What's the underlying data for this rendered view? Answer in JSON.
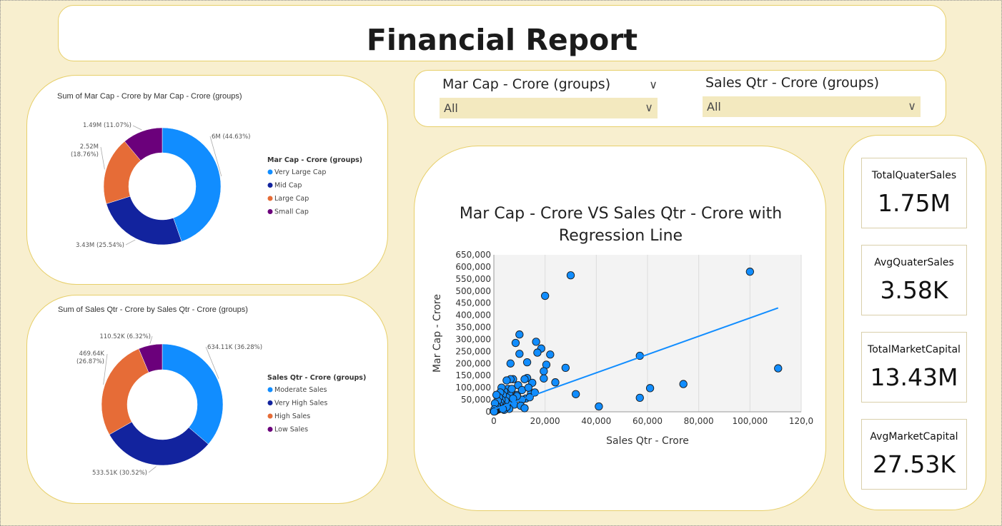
{
  "report_title": "Financial Report",
  "slicers": [
    {
      "label": "Mar Cap - Crore (groups)",
      "value": "All"
    },
    {
      "label": "Sales Qtr - Crore (groups)",
      "value": "All"
    }
  ],
  "kpis": [
    {
      "label": "TotalQuaterSales",
      "value": "1.75M"
    },
    {
      "label": "AvgQuaterSales",
      "value": "3.58K"
    },
    {
      "label": "TotalMarketCapital",
      "value": "13.43M"
    },
    {
      "label": "AvgMarketCapital",
      "value": "27.53K"
    }
  ],
  "chart_data": [
    {
      "type": "pie",
      "title": "Sum of Mar Cap - Crore by Mar Cap - Crore (groups)",
      "legend_title": "Mar Cap - Crore (groups)",
      "legend_position": "right",
      "slices": [
        {
          "name": "Very Large Cap",
          "label": "6M (44.63%)",
          "value": 6.0,
          "percent": 44.63,
          "color": "#118dff"
        },
        {
          "name": "Mid Cap",
          "label": "3.43M (25.54%)",
          "value": 3.43,
          "percent": 25.54,
          "color": "#12239e"
        },
        {
          "name": "Large Cap",
          "label": "2.52M (18.76%)",
          "value": 2.52,
          "percent": 18.76,
          "color": "#e66c37"
        },
        {
          "name": "Small Cap",
          "label": "1.49M (11.07%)",
          "value": 1.49,
          "percent": 11.07,
          "color": "#6b007b"
        }
      ]
    },
    {
      "type": "pie",
      "title": "Sum of Sales Qtr - Crore by Sales Qtr - Crore (groups)",
      "legend_title": "Sales Qtr - Crore (groups)",
      "legend_position": "right",
      "slices": [
        {
          "name": "Moderate Sales",
          "label": "634.11K (36.28%)",
          "value": 634.11,
          "percent": 36.28,
          "color": "#118dff"
        },
        {
          "name": "Very High Sales",
          "label": "533.51K (30.52%)",
          "value": 533.51,
          "percent": 30.52,
          "color": "#12239e"
        },
        {
          "name": "High Sales",
          "label": "469.64K (26.87%)",
          "value": 469.64,
          "percent": 26.87,
          "color": "#e66c37"
        },
        {
          "name": "Low Sales",
          "label": "110.52K (6.32%)",
          "value": 110.52,
          "percent": 6.32,
          "color": "#6b007b"
        }
      ]
    },
    {
      "type": "scatter",
      "title": "Mar Cap - Crore VS Sales Qtr - Crore with Regression Line",
      "xlabel": "Sales Qtr - Crore",
      "ylabel": "Mar Cap - Crore",
      "xlim": [
        0,
        120000
      ],
      "ylim": [
        0,
        650000
      ],
      "x_ticks": [
        "0",
        "20,000",
        "40,000",
        "60,000",
        "80,000",
        "100,000",
        "120,0"
      ],
      "y_ticks": [
        "0",
        "50,000",
        "100,000",
        "150,000",
        "200,000",
        "250,000",
        "300,000",
        "350,000",
        "400,000",
        "450,000",
        "500,000",
        "550,000",
        "600,000",
        "650,000"
      ],
      "grid": true,
      "point_color": "#118dff",
      "regression_line": {
        "x": [
          0,
          111000
        ],
        "y": [
          10000,
          430000
        ],
        "color": "#118dff"
      },
      "points": [
        [
          100000,
          580000
        ],
        [
          30000,
          565000
        ],
        [
          20000,
          480000
        ],
        [
          111000,
          180000
        ],
        [
          74000,
          115000
        ],
        [
          57000,
          232000
        ],
        [
          61000,
          98000
        ],
        [
          57000,
          58000
        ],
        [
          41000,
          22000
        ],
        [
          32000,
          73000
        ],
        [
          28000,
          182000
        ],
        [
          24000,
          122000
        ],
        [
          22000,
          237000
        ],
        [
          20500,
          195000
        ],
        [
          19500,
          168000
        ],
        [
          19500,
          138000
        ],
        [
          18500,
          262000
        ],
        [
          17000,
          245000
        ],
        [
          16500,
          290000
        ],
        [
          14500,
          75000
        ],
        [
          13000,
          205000
        ],
        [
          13000,
          140000
        ],
        [
          12500,
          55000
        ],
        [
          12000,
          135000
        ],
        [
          11000,
          50000
        ],
        [
          10000,
          320000
        ],
        [
          10000,
          240000
        ],
        [
          9500,
          110000
        ],
        [
          9000,
          70000
        ],
        [
          8500,
          285000
        ],
        [
          8000,
          50000
        ],
        [
          7500,
          135000
        ],
        [
          7000,
          50000
        ],
        [
          6500,
          200000
        ],
        [
          6500,
          135000
        ],
        [
          6000,
          75000
        ],
        [
          6000,
          30000
        ],
        [
          5500,
          95000
        ],
        [
          5000,
          130000
        ],
        [
          5000,
          60000
        ],
        [
          4500,
          45000
        ],
        [
          4000,
          85000
        ],
        [
          3500,
          70000
        ],
        [
          3200,
          30000
        ],
        [
          3000,
          100000
        ],
        [
          3000,
          50000
        ],
        [
          2800,
          20000
        ],
        [
          2500,
          80000
        ],
        [
          2500,
          40000
        ],
        [
          2200,
          15000
        ],
        [
          2000,
          60000
        ],
        [
          2000,
          30000
        ],
        [
          1800,
          10000
        ],
        [
          1500,
          45000
        ],
        [
          1500,
          20000
        ],
        [
          1200,
          8000
        ],
        [
          1000,
          70000
        ],
        [
          1000,
          25000
        ],
        [
          800,
          5000
        ],
        [
          600,
          15000
        ],
        [
          500,
          3000
        ],
        [
          400,
          35000
        ],
        [
          300,
          2000
        ],
        [
          200,
          10000
        ],
        [
          100,
          1000
        ],
        [
          15000,
          120000
        ],
        [
          11000,
          90000
        ],
        [
          9000,
          65000
        ],
        [
          7000,
          95000
        ],
        [
          13500,
          100000
        ],
        [
          8000,
          30000
        ],
        [
          10500,
          25000
        ],
        [
          12000,
          15000
        ],
        [
          6000,
          12000
        ],
        [
          4000,
          8000
        ],
        [
          14000,
          60000
        ],
        [
          16000,
          80000
        ],
        [
          5000,
          20000
        ],
        [
          3500,
          12000
        ],
        [
          7500,
          55000
        ]
      ]
    }
  ]
}
